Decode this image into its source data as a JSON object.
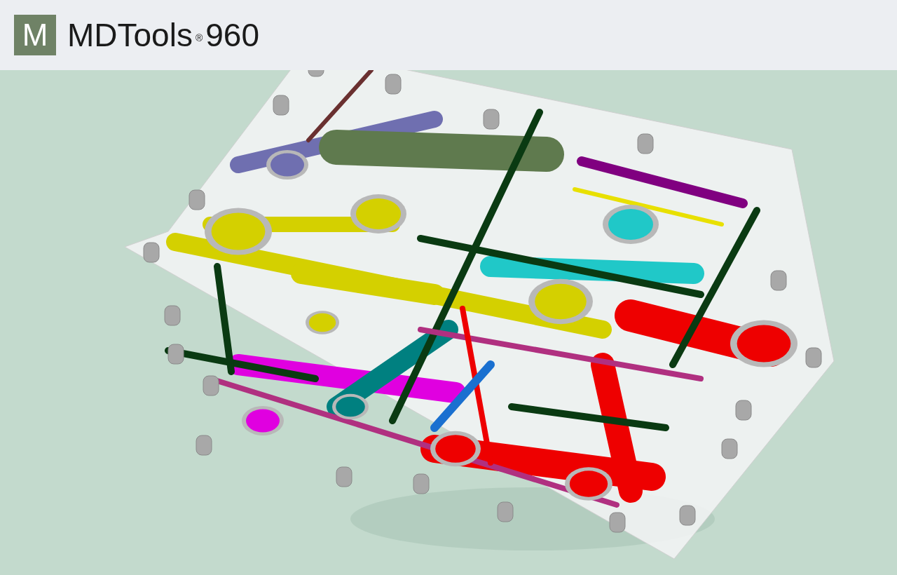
{
  "header": {
    "logo_letter": "M",
    "brand": "MDTools",
    "registered": "®",
    "version": "960"
  }
}
